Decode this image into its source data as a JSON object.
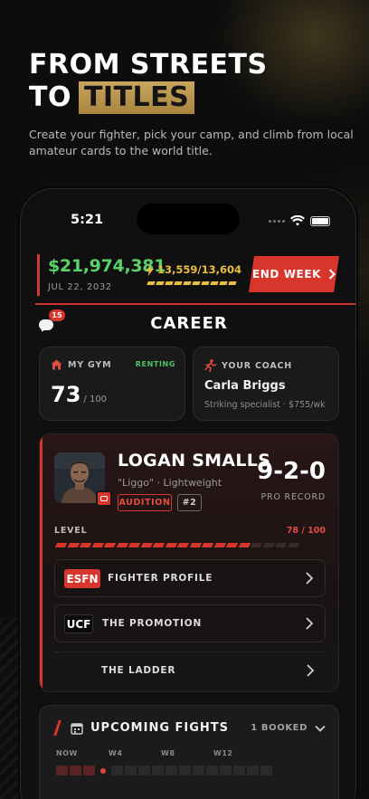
{
  "hero": {
    "line1": "FROM STREETS",
    "line2_prefix": "TO",
    "line2_highlight": "TITLES",
    "subtitle": "Create your fighter, pick your camp, and climb from local amateur cards to the world title."
  },
  "status_bar": {
    "time": "5:21"
  },
  "header": {
    "money": "$21,974,381",
    "date": "JUL 22, 2032",
    "energy": "13,559/13,604",
    "energy_fraction": 0.997,
    "end_week_label": "END WEEK"
  },
  "career": {
    "title": "CAREER",
    "notification_count": "15"
  },
  "gym": {
    "label": "MY GYM",
    "status": "RENTING",
    "value": "73",
    "max": "/ 100"
  },
  "coach": {
    "label": "YOUR COACH",
    "name": "Carla Briggs",
    "desc": "Striking specialist · $755/wk"
  },
  "fighter": {
    "name": "LOGAN SMALLS",
    "nickname": "\"Liggo\" · Lightweight",
    "tag1": "AUDITION",
    "tag2": "#2",
    "record": "9-2-0",
    "record_label": "PRO RECORD",
    "level_label": "LEVEL",
    "level_value": "78 / 100",
    "level_fraction": 0.78
  },
  "links": [
    {
      "logo": "ESFN",
      "label": "FIGHTER PROFILE"
    },
    {
      "logo": "UCF",
      "label": "THE PROMOTION"
    },
    {
      "logo": "",
      "label": "THE LADDER"
    }
  ],
  "upcoming": {
    "title": "UPCOMING FIGHTS",
    "booked": "1 BOOKED",
    "weeks": [
      "NOW",
      "W4",
      "W8",
      "W12"
    ]
  },
  "colors": {
    "accent": "#d8362c",
    "money": "#5cd16a",
    "energy": "#e8bf3e",
    "gold": "#c9a55e"
  }
}
